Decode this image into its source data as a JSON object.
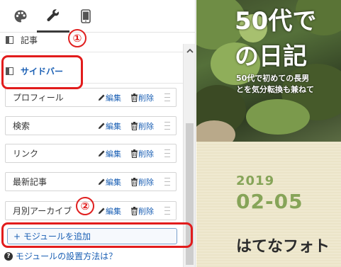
{
  "tabs": [
    {
      "icon": "palette-icon"
    },
    {
      "icon": "wrench-icon",
      "active": true
    },
    {
      "icon": "phone-icon"
    }
  ],
  "sections": {
    "article": "記事",
    "sidebar": "サイドバー"
  },
  "modules": [
    {
      "label": "プロフィール",
      "edit": "編集",
      "delete": "削除"
    },
    {
      "label": "検索",
      "edit": "編集",
      "delete": "削除"
    },
    {
      "label": "リンク",
      "edit": "編集",
      "delete": "削除"
    },
    {
      "label": "最新記事",
      "edit": "編集",
      "delete": "削除"
    },
    {
      "label": "月別アーカイブ",
      "edit": "編集",
      "delete": "削除"
    }
  ],
  "add_module": "+ モジュールを追加",
  "help_text": "モジュールの設置方法は？",
  "annotations": {
    "one": "①",
    "two": "②"
  },
  "preview": {
    "title_line1": "50代で",
    "title_line2": "の日記",
    "subtitle_line1": "50代で初めての長男",
    "subtitle_line2": "とを気分転換も兼ねて",
    "date_year": "2019",
    "date_md": "02-05",
    "post_title": "はてなフォト"
  },
  "colors": {
    "link": "#1a5fb4",
    "annotation": "#e21c1c",
    "date": "#86a458"
  }
}
